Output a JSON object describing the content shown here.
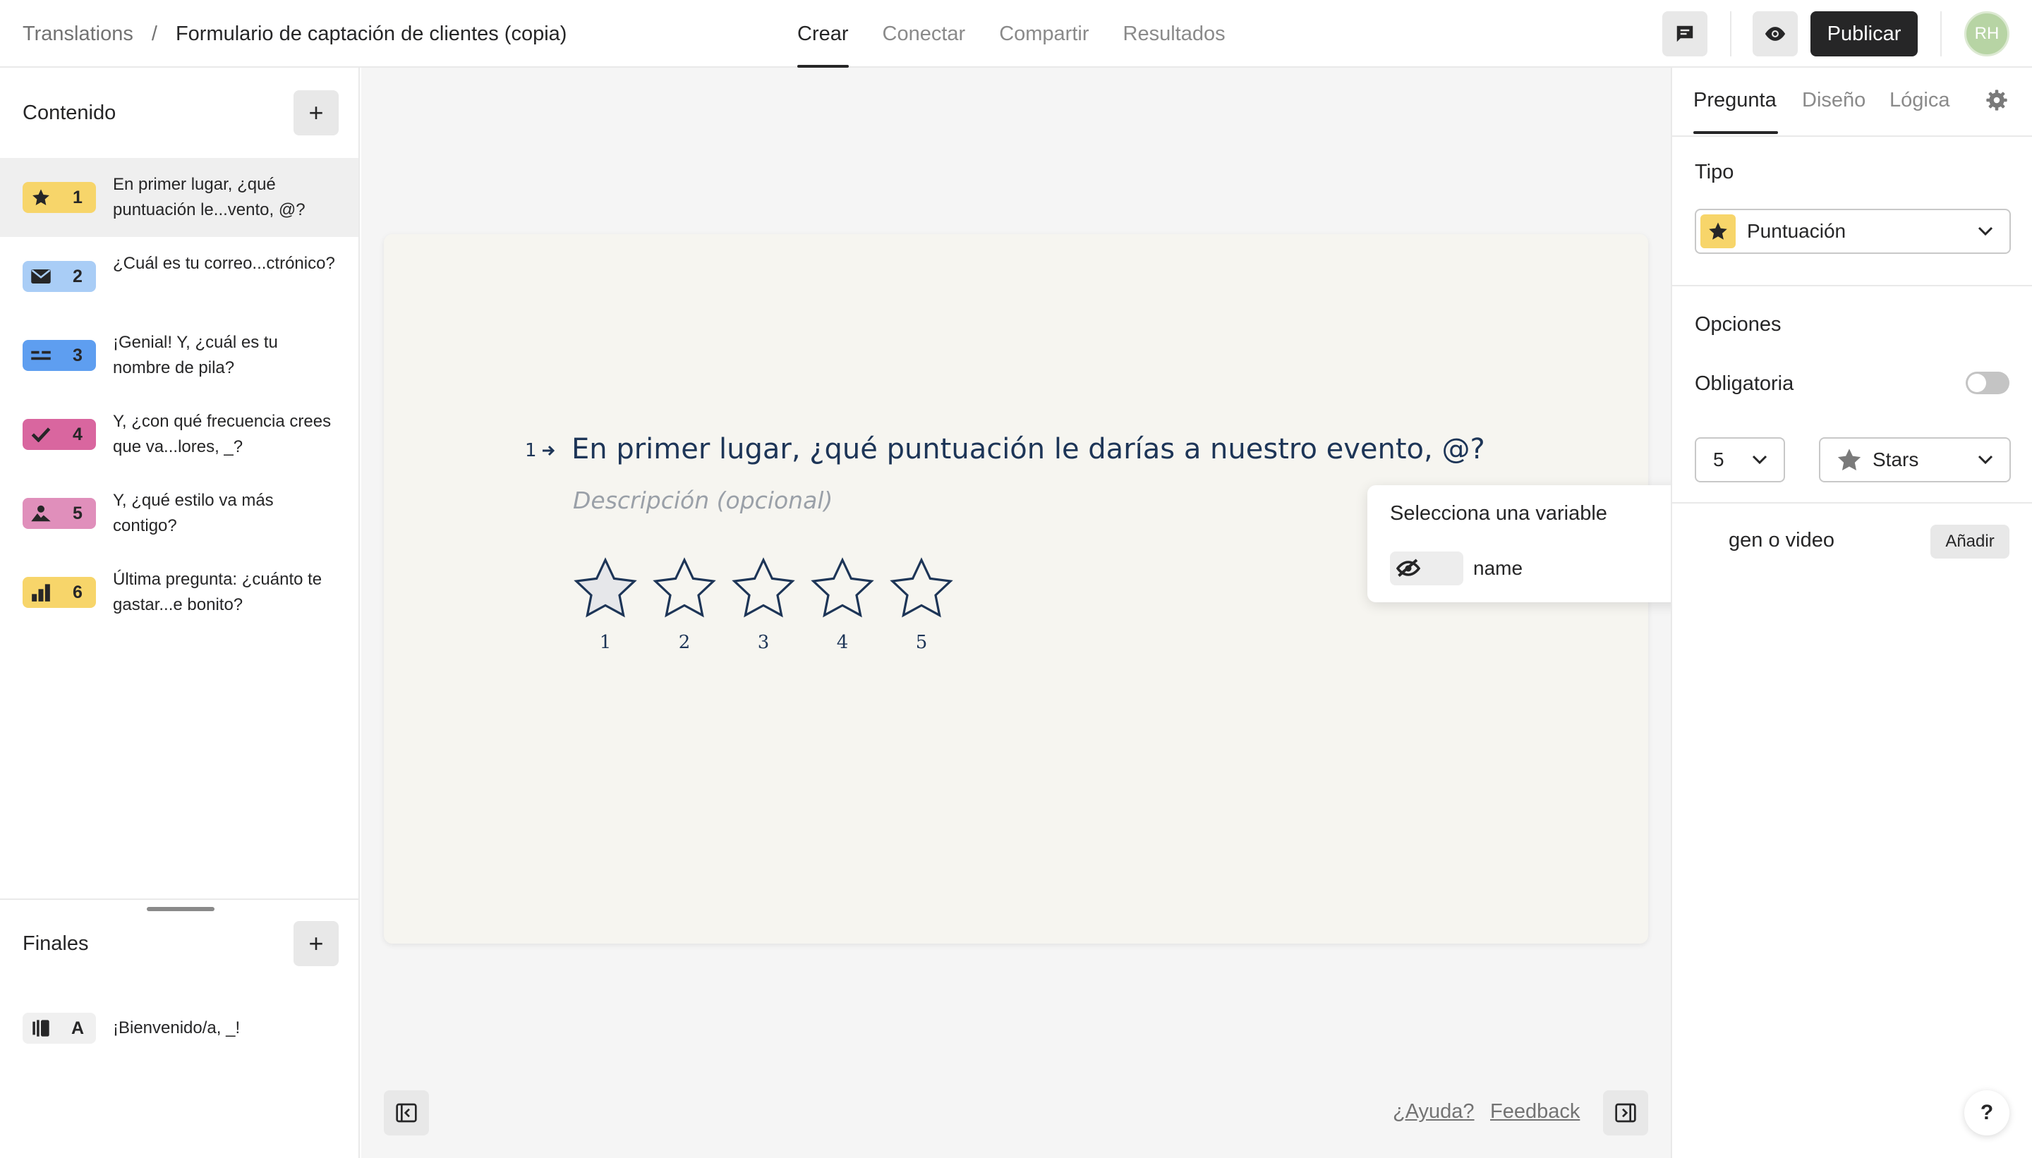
{
  "breadcrumb": {
    "root": "Translations",
    "separator": "/",
    "current": "Formulario de captación de clientes (copia)"
  },
  "tabs": [
    "Crear",
    "Conectar",
    "Compartir",
    "Resultados"
  ],
  "toolbar": {
    "publish_label": "Publicar",
    "avatar_initials": "RH"
  },
  "sidebar": {
    "content_heading": "Contenido",
    "add_symbol": "+",
    "questions": [
      {
        "num": "1",
        "text": "En primer lugar, ¿qué puntuación le...vento, @?",
        "icon": "star-icon",
        "color": "#f7d56a"
      },
      {
        "num": "2",
        "text": "¿Cuál es tu correo...ctrónico?",
        "icon": "mail-icon",
        "color": "#a9cdf6"
      },
      {
        "num": "3",
        "text": "¡Genial! Y, ¿cuál es tu nombre de pila?",
        "icon": "short-text-icon",
        "color": "#5e9ef0"
      },
      {
        "num": "4",
        "text": "Y, ¿con qué frecuencia crees que va...lores, _?",
        "icon": "checkmark-icon",
        "color": "#d9669f"
      },
      {
        "num": "5",
        "text": "Y, ¿qué estilo va más contigo?",
        "icon": "picture-choice-icon",
        "color": "#e08fbb"
      },
      {
        "num": "6",
        "text": "Última pregunta: ¿cuánto te gastar...e bonito?",
        "icon": "bar-chart-icon",
        "color": "#f7d56a"
      }
    ],
    "endings_heading": "Finales",
    "endings": [
      {
        "letter": "A",
        "text": "¡Bienvenido/a, _!",
        "icon": "ending-screen-icon",
        "color": "#f0f0f0"
      }
    ]
  },
  "canvas": {
    "question_number": "1",
    "question_title": "En primer lugar, ¿qué puntuación le darías a nuestro evento, @?",
    "description_placeholder": "Descripción (opcional)",
    "rating_labels": [
      "1",
      "2",
      "3",
      "4",
      "5"
    ],
    "variable_popover": {
      "title": "Selecciona una variable",
      "variable_name": "name",
      "variable_icon": "hidden-eye-icon"
    },
    "help_link": "¿Ayuda?",
    "feedback_link": "Feedback"
  },
  "right_panel": {
    "tabs": [
      "Pregunta",
      "Diseño",
      "Lógica"
    ],
    "type_label": "Tipo",
    "type_value": "Puntuación",
    "options_label": "Opciones",
    "required_label": "Obligatoria",
    "required_on": false,
    "steps_value": "5",
    "shape_value": "Stars",
    "media_label": "gen o video",
    "add_label": "Añadir",
    "help_symbol": "?"
  },
  "colors": {
    "accent_dark": "#262627",
    "question_text": "#1d3557",
    "rating_yellow": "#f7d56a"
  }
}
